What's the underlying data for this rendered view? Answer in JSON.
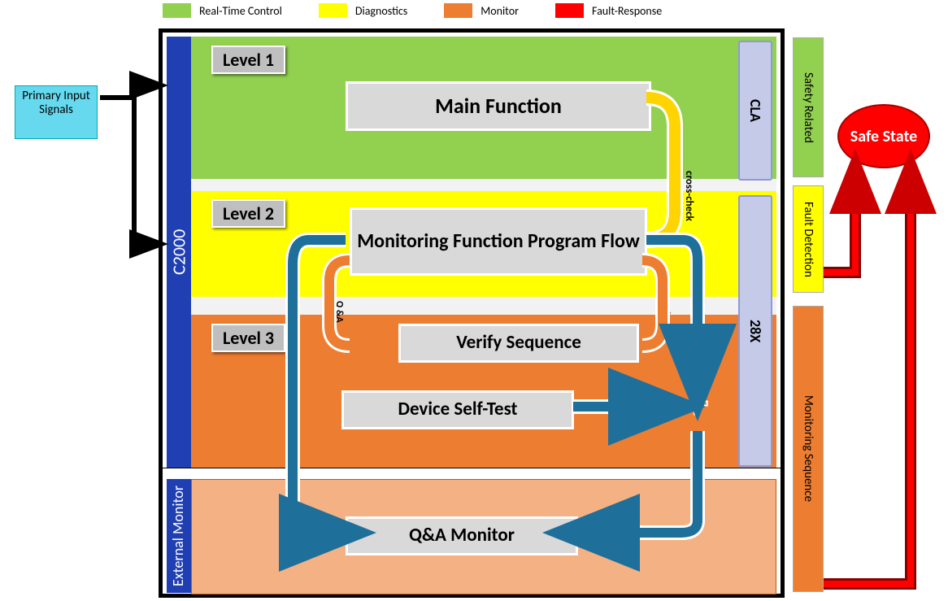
{
  "legend": {
    "rtc": "Real-Time Control",
    "diag": "Diagnostics",
    "mon": "Monitor",
    "fault": "Fault-Response"
  },
  "primary_signals": "Primary Input Signals",
  "c2000": "C2000",
  "ext_monitor": "External Monitor",
  "level1": "Level 1",
  "level2": "Level 2",
  "level3": "Level 3",
  "boxes": {
    "mainfunc": "Main Function",
    "monflow": "Monitoring Function Program Flow",
    "verify": "Verify Sequence",
    "selftest": "Device Self-Test",
    "qamon": "Q&A Monitor"
  },
  "sidebars": {
    "cla": "CLA",
    "x28": "28X"
  },
  "rightcol": {
    "safety": "Safety Related",
    "fault": "Fault Detection",
    "mon": "Monitoring Sequence"
  },
  "safestate": "Safe State",
  "labels": {
    "crosscheck": "cross-check",
    "qa": "Q &A"
  },
  "plus": "+"
}
